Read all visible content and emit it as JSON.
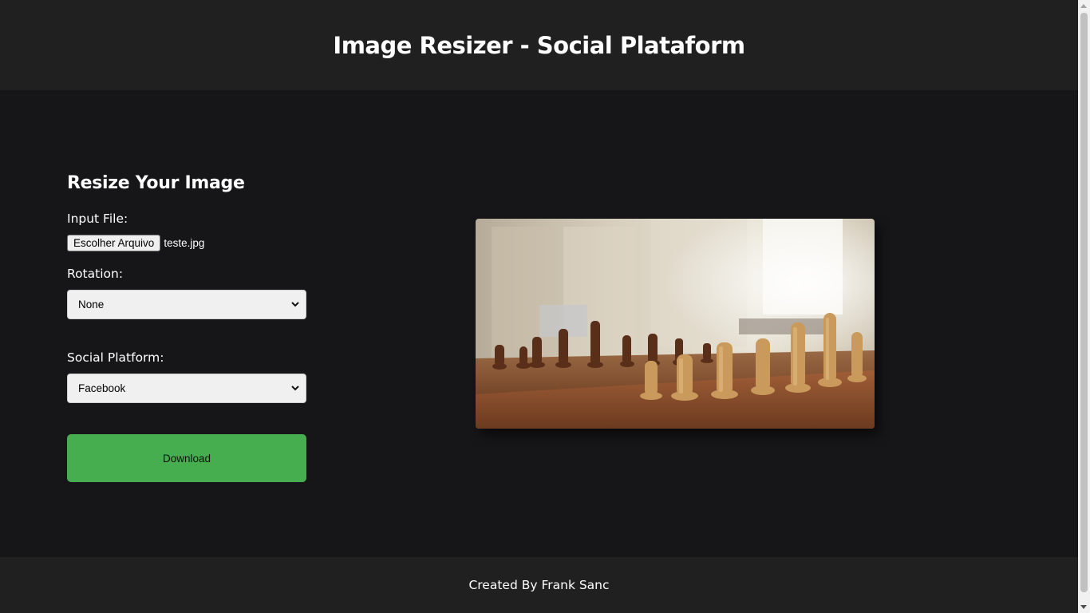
{
  "header": {
    "title": "Image Resizer - Social Plataform"
  },
  "form": {
    "title": "Resize Your Image",
    "input_file_label": "Input File:",
    "file_button_label": "Escolher Arquivo",
    "file_name": "teste.jpg",
    "rotation_label": "Rotation:",
    "rotation_value": "None",
    "platform_label": "Social Platform:",
    "platform_value": "Facebook",
    "download_label": "Download"
  },
  "preview": {
    "icon": "chess-board-photo"
  },
  "footer": {
    "credit": "Created By Frank Sanc"
  },
  "colors": {
    "header_bg": "#202020",
    "main_bg": "#161618",
    "download_button": "#46ae4e"
  }
}
